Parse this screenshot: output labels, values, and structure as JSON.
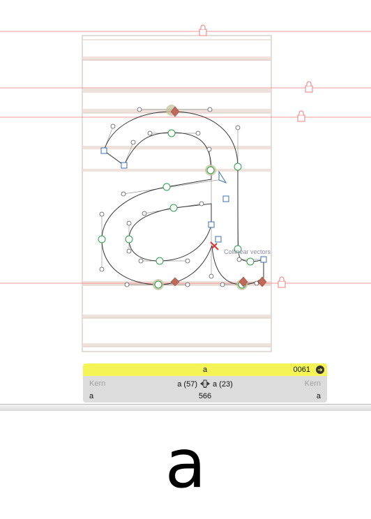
{
  "editor": {
    "glyph_outline": "a",
    "hint_label": "Collinear vectors",
    "colors": {
      "metric_line": "#f07a7a",
      "zone": "#efe2dc",
      "outline": "#333333",
      "node_green": "#2aa04a",
      "handle_blue": "#3a6fb0",
      "anchor_brown": "#c0685a",
      "flag_red": "#dd3333"
    }
  },
  "info_panel": {
    "glyph_name": "a",
    "unicode": "0061",
    "unicode_icon": "arrow-circle-icon",
    "kern_left_label": "Kern",
    "kern_right_label": "Kern",
    "left_sidebearing": "a (57)",
    "right_sidebearing": "a (23)",
    "sidebearing_icon": "sidebearing-link-icon",
    "left_neighbor": "a",
    "right_neighbor": "a",
    "advance_width": "566"
  },
  "preview": {
    "text": "a"
  }
}
